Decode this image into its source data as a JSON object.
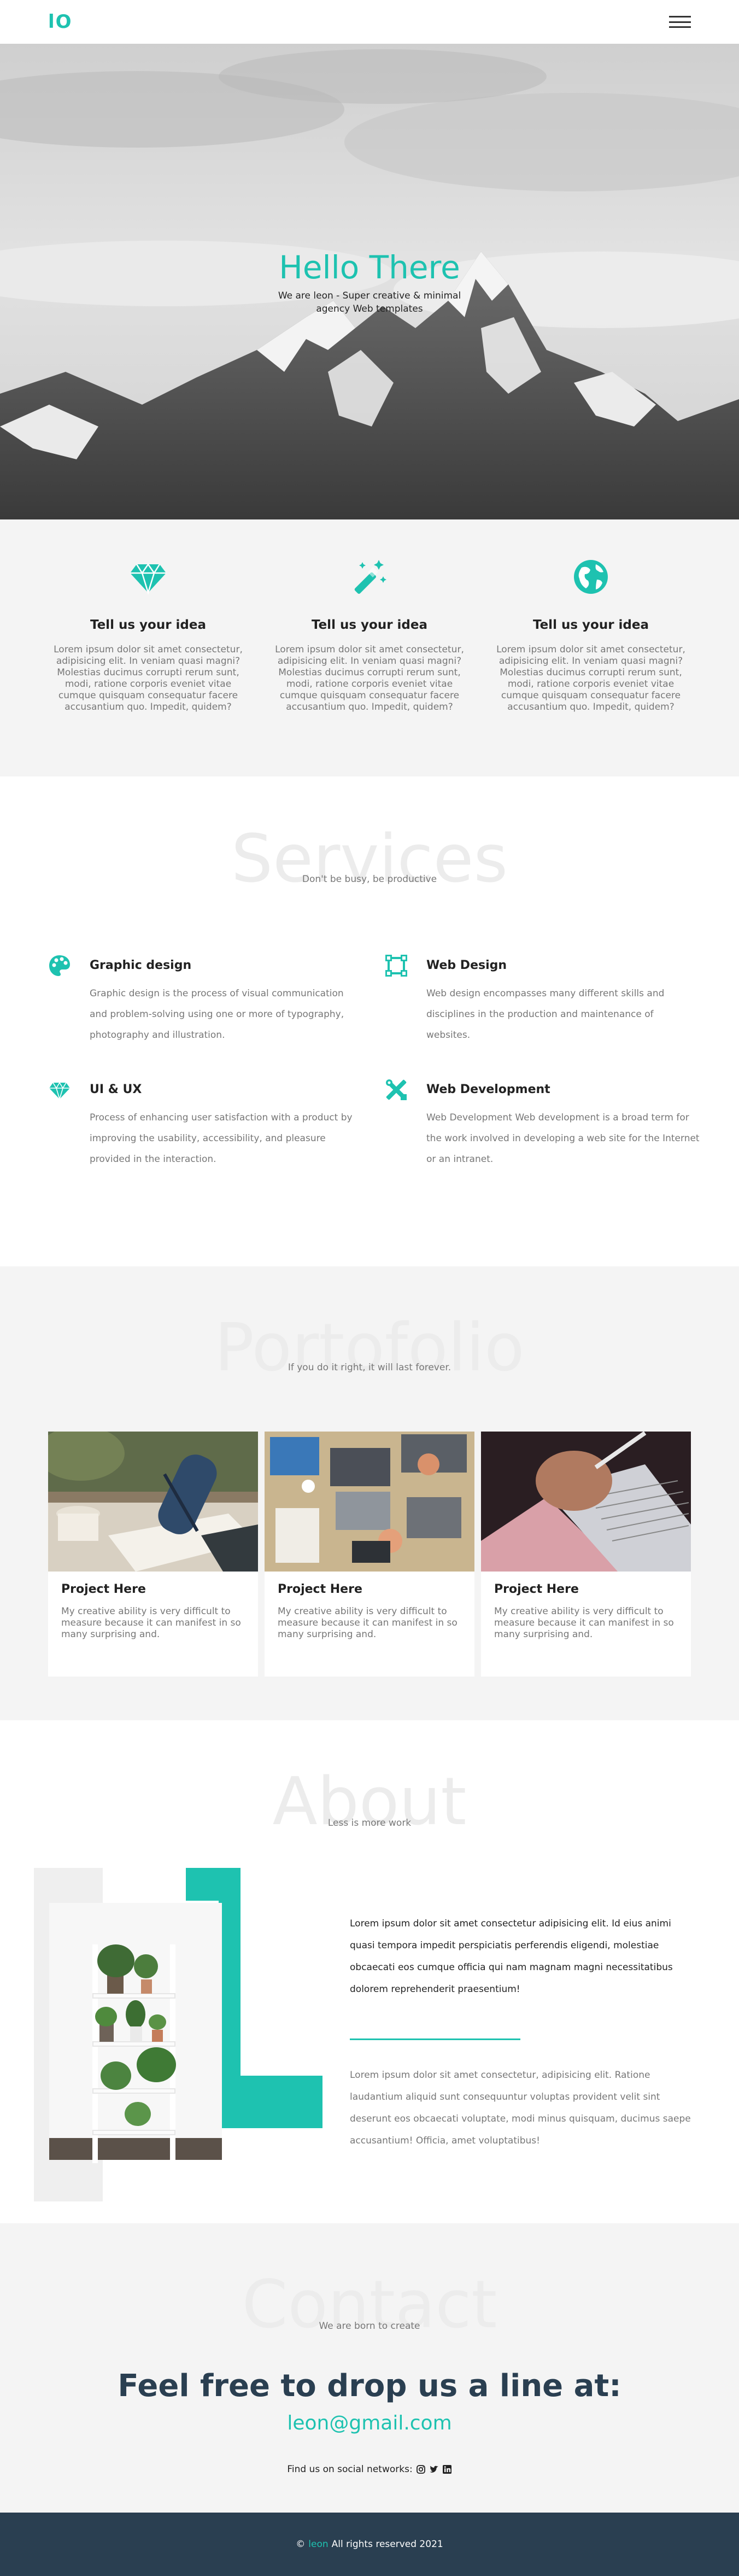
{
  "nav": {
    "logo": "lO",
    "menu_icon": "menu-icon"
  },
  "hero": {
    "title": "Hello There",
    "subtitle": "We are leon - Super creative & minimal agency Web templates"
  },
  "features": [
    {
      "icon": "diamond-icon",
      "title": "Tell us your idea",
      "text": "Lorem ipsum dolor sit amet consectetur, adipisicing elit. In veniam quasi magni? Molestias ducimus corrupti rerum sunt, modi, ratione corporis eveniet vitae cumque quisquam consequatur facere accusantium quo. Impedit, quidem?"
    },
    {
      "icon": "magic-wand-icon",
      "title": "Tell us your idea",
      "text": "Lorem ipsum dolor sit amet consectetur, adipisicing elit. In veniam quasi magni? Molestias ducimus corrupti rerum sunt, modi, ratione corporis eveniet vitae cumque quisquam consequatur facere accusantium quo. Impedit, quidem?"
    },
    {
      "icon": "globe-icon",
      "title": "Tell us your idea",
      "text": "Lorem ipsum dolor sit amet consectetur, adipisicing elit. In veniam quasi magni? Molestias ducimus corrupti rerum sunt, modi, ratione corporis eveniet vitae cumque quisquam consequatur facere accusantium quo. Impedit, quidem?"
    }
  ],
  "services": {
    "heading": "Services",
    "subheading": "Don't be busy, be productive",
    "items": [
      {
        "icon": "palette-icon",
        "title": "Graphic design",
        "text": "Graphic design is the process of visual communication and problem-solving using one or more of typography, photography and illustration."
      },
      {
        "icon": "vector-square-icon",
        "title": "Web Design",
        "text": "Web design encompasses many different skills and disciplines in the production and maintenance of websites."
      },
      {
        "icon": "diamond-icon",
        "title": "UI & UX",
        "text": "Process of enhancing user satisfaction with a product by improving the usability, accessibility, and pleasure provided in the interaction."
      },
      {
        "icon": "tools-icon",
        "title": "Web Development",
        "text": "Web Development Web development is a broad term for the work involved in developing a web site for the Internet or an intranet."
      }
    ]
  },
  "portfolio": {
    "heading": "Portofolio",
    "subheading": "If you do it right, it will last forever.",
    "cards": [
      {
        "title": "Project Here",
        "text": "My creative ability is very difficult to measure because it can manifest in so many surprising and."
      },
      {
        "title": "Project Here",
        "text": "My creative ability is very difficult to measure because it can manifest in so many surprising and."
      },
      {
        "title": "Project Here",
        "text": "My creative ability is very difficult to measure because it can manifest in so many surprising and."
      }
    ]
  },
  "about": {
    "heading": "About",
    "subheading": "Less is more work",
    "lead": "Lorem ipsum dolor sit amet consectetur adipisicing elit. Id eius animi quasi tempora impedit perspiciatis perferendis eligendi, molestiae obcaecati eos cumque officia qui nam magnam magni necessitatibus dolorem reprehenderit praesentium!",
    "text": "Lorem ipsum dolor sit amet consectetur, adipisicing elit. Ratione laudantium aliquid sunt consequuntur voluptas provident velit sint deserunt eos obcaecati voluptate, modi minus quisquam, ducimus saepe accusantium! Officia, amet voluptatibus!"
  },
  "contact": {
    "heading": "Contact",
    "subheading": "We are born to create",
    "lead": "Feel free to drop us a line at:",
    "email": "leon@gmail.com",
    "social_label": "Find us on social networks:",
    "social_icons": [
      "instagram-icon",
      "twitter-icon",
      "linkedin-icon"
    ]
  },
  "footer": {
    "copyright_symbol": "©",
    "brand": "leon",
    "rights": "All rights reserved 2021"
  },
  "colors": {
    "accent": "#1ec2b0",
    "dark": "#2a3f51",
    "light_bg": "#f4f4f4"
  }
}
